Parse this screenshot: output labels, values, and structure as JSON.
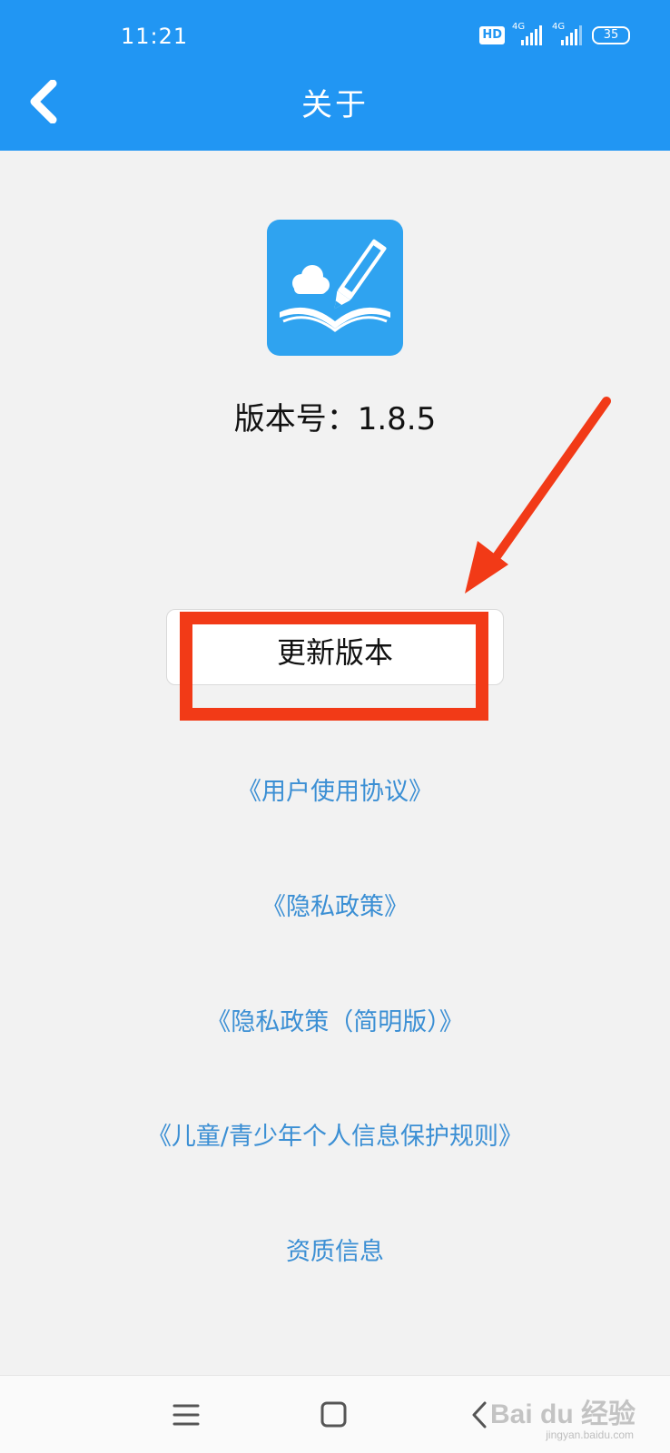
{
  "status_bar": {
    "time": "11:21",
    "hd_label": "HD",
    "network_1": "4G",
    "network_2": "4G",
    "battery": "35"
  },
  "header": {
    "title": "关于"
  },
  "app": {
    "version_text": "版本号：1.8.5"
  },
  "update_button": {
    "label": "更新版本"
  },
  "links": [
    {
      "label": "《用户使用协议》"
    },
    {
      "label": "《隐私政策》"
    },
    {
      "label": "《隐私政策（简明版）》"
    },
    {
      "label": "《儿童/青少年个人信息保护规则》"
    },
    {
      "label": "资质信息"
    }
  ],
  "watermark": {
    "brand": "Bai du 经验",
    "url": "jingyan.baidu.com"
  },
  "colors": {
    "primary": "#2196f3",
    "link": "#3b8fd4",
    "annotation": "#f23a17",
    "background": "#f2f2f2"
  }
}
